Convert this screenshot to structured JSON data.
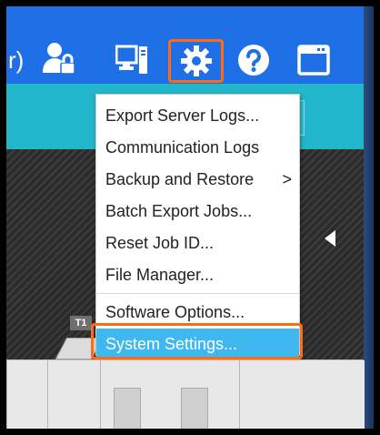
{
  "toolbar": {
    "partial_text": "r)",
    "icons": [
      "user-lock-icon",
      "computer-tower-icon",
      "gear-icon",
      "help-icon",
      "window-icon"
    ],
    "accent_color": "#1f6fe6",
    "highlight_color": "#ff6a13"
  },
  "menu": {
    "items": [
      {
        "label": "Export Server Logs..."
      },
      {
        "label": "Communication Logs"
      },
      {
        "label": "Backup and Restore",
        "submenu": ">"
      },
      {
        "label": "Batch Export Jobs..."
      },
      {
        "label": "Reset Job ID..."
      },
      {
        "label": "File Manager..."
      },
      {
        "label": "Software Options..."
      },
      {
        "label": "System Settings...",
        "selected": true
      }
    ],
    "selected_color": "#3fb7ef"
  },
  "device": {
    "tray_label": "T1"
  }
}
